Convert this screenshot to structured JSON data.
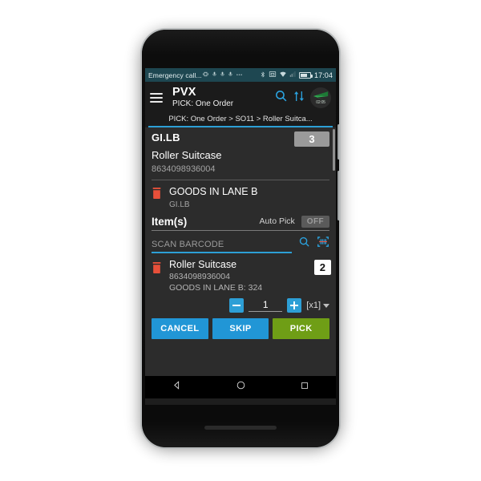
{
  "device": {
    "name": "android-phone",
    "earpiece": "earpiece-speaker",
    "camera": "front-camera"
  },
  "statusbar": {
    "carrier_text": "Emergency call...",
    "clock": "17:04",
    "icons": [
      "vibrate-icon",
      "signal-icon-1",
      "signal-icon-2",
      "signal-icon-3",
      "more-icon",
      "bluetooth-icon",
      "screencast-icon",
      "wifi-icon",
      "cellular-signal-icon",
      "battery-icon"
    ],
    "bg_color": "#1e4751"
  },
  "appbar": {
    "menu_icon": "hamburger-menu-icon",
    "title": "PVX",
    "subtitle": "PICK: One Order",
    "search_icon": "search-icon",
    "sort_icon": "sort-transfer-icon",
    "logo_icon": "green-arrow-logo-icon",
    "logo_timer": "02:05"
  },
  "breadcrumb": {
    "text": "PICK: One Order > SO11 > Roller Suitca...",
    "accent_color": "#2d9fd6"
  },
  "header": {
    "code": "GI.LB",
    "qty_badge": "3",
    "product_name": "Roller Suitcase",
    "barcode": "8634098936004"
  },
  "location": {
    "delete_icon": "trash-icon",
    "title": "GOODS IN LANE B",
    "subtitle": "GI.LB"
  },
  "items_bar": {
    "label": "Item(s)",
    "autopick_label": "Auto Pick",
    "autopick_state": "OFF"
  },
  "scan": {
    "placeholder": "SCAN BARCODE",
    "value": "",
    "search_icon": "search-icon",
    "barcode_icon": "barcode-scan-icon"
  },
  "item": {
    "delete_icon": "trash-icon",
    "name": "Roller Suitcase",
    "barcode": "8634098936004",
    "location_qty": "GOODS IN LANE B: 324",
    "qty_badge": "2"
  },
  "stepper": {
    "minus_icon": "minus-icon",
    "plus_icon": "plus-icon",
    "quantity": "1",
    "multiplier": "[x1]",
    "caret_icon": "chevron-down-icon"
  },
  "actions": {
    "cancel": "CANCEL",
    "skip": "SKIP",
    "pick": "PICK",
    "cancel_color": "#2196d6",
    "skip_color": "#2196d6",
    "pick_color": "#6f9e16"
  },
  "navbar": {
    "back": "back-triangle-icon",
    "home": "home-circle-icon",
    "recents": "recents-square-icon"
  }
}
